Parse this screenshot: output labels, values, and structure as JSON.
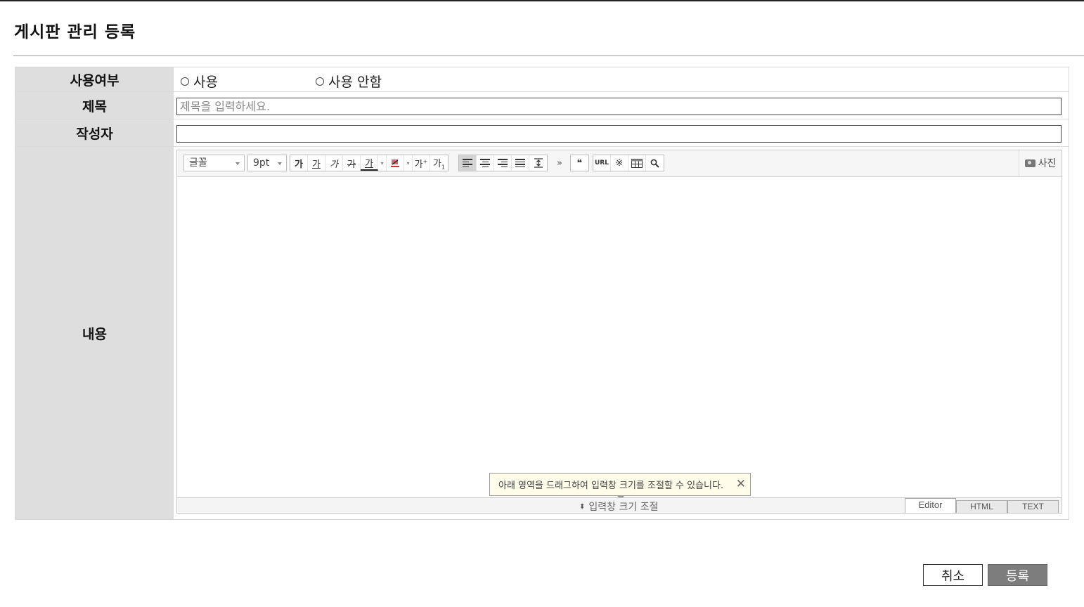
{
  "page": {
    "title": "게시판 관리 등록"
  },
  "form": {
    "use_label": "사용여부",
    "use_option": "사용",
    "not_use_option": "사용 안함",
    "title_label": "제목",
    "title_placeholder": "제목을 입력하세요.",
    "author_label": "작성자",
    "author_value": "",
    "content_label": "내용"
  },
  "editor": {
    "font_select": "글꼴",
    "size_select": "9pt",
    "toolbar_glyph": "가",
    "more_glyph": "»",
    "quote_glyph": "❝",
    "url_label": "URL",
    "special_char_glyph": "※",
    "photo_label": "사진",
    "tooltip_text": "아래 영역을 드래그하여 입력창 크기를 조절할 수 있습니다.",
    "tooltip_close": "✕",
    "resize_label": "입력창 크기 조절",
    "resize_arrows": "⬍",
    "mode_tabs": [
      "Editor",
      "HTML",
      "TEXT"
    ]
  },
  "actions": {
    "cancel_label": "취소",
    "submit_label": "등록"
  }
}
